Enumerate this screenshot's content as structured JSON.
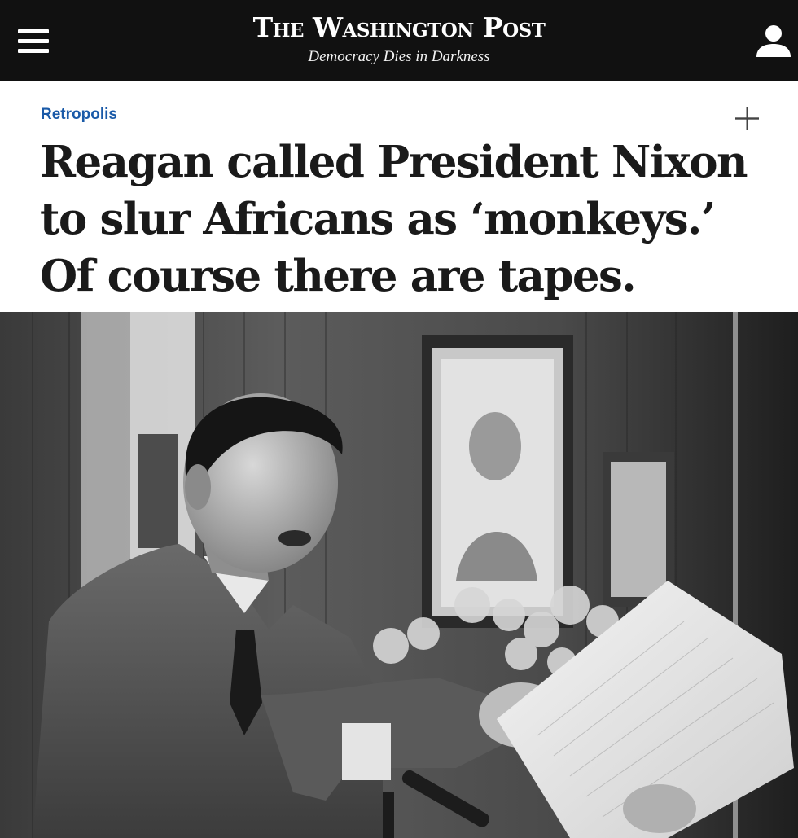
{
  "header": {
    "logo": "The Washington Post",
    "tagline": "Democracy Dies in Darkness",
    "menu_icon": "hamburger-menu-icon",
    "user_icon": "user-icon"
  },
  "article": {
    "kicker": "Retropolis",
    "headline": "Reagan called President Nixon to slur Africans as ‘monkeys.’ Of course there are tapes.",
    "add_icon": "plus-icon"
  },
  "colors": {
    "topbar": "#111111",
    "kicker": "#1a5aa8",
    "headline": "#1a1a1a"
  }
}
